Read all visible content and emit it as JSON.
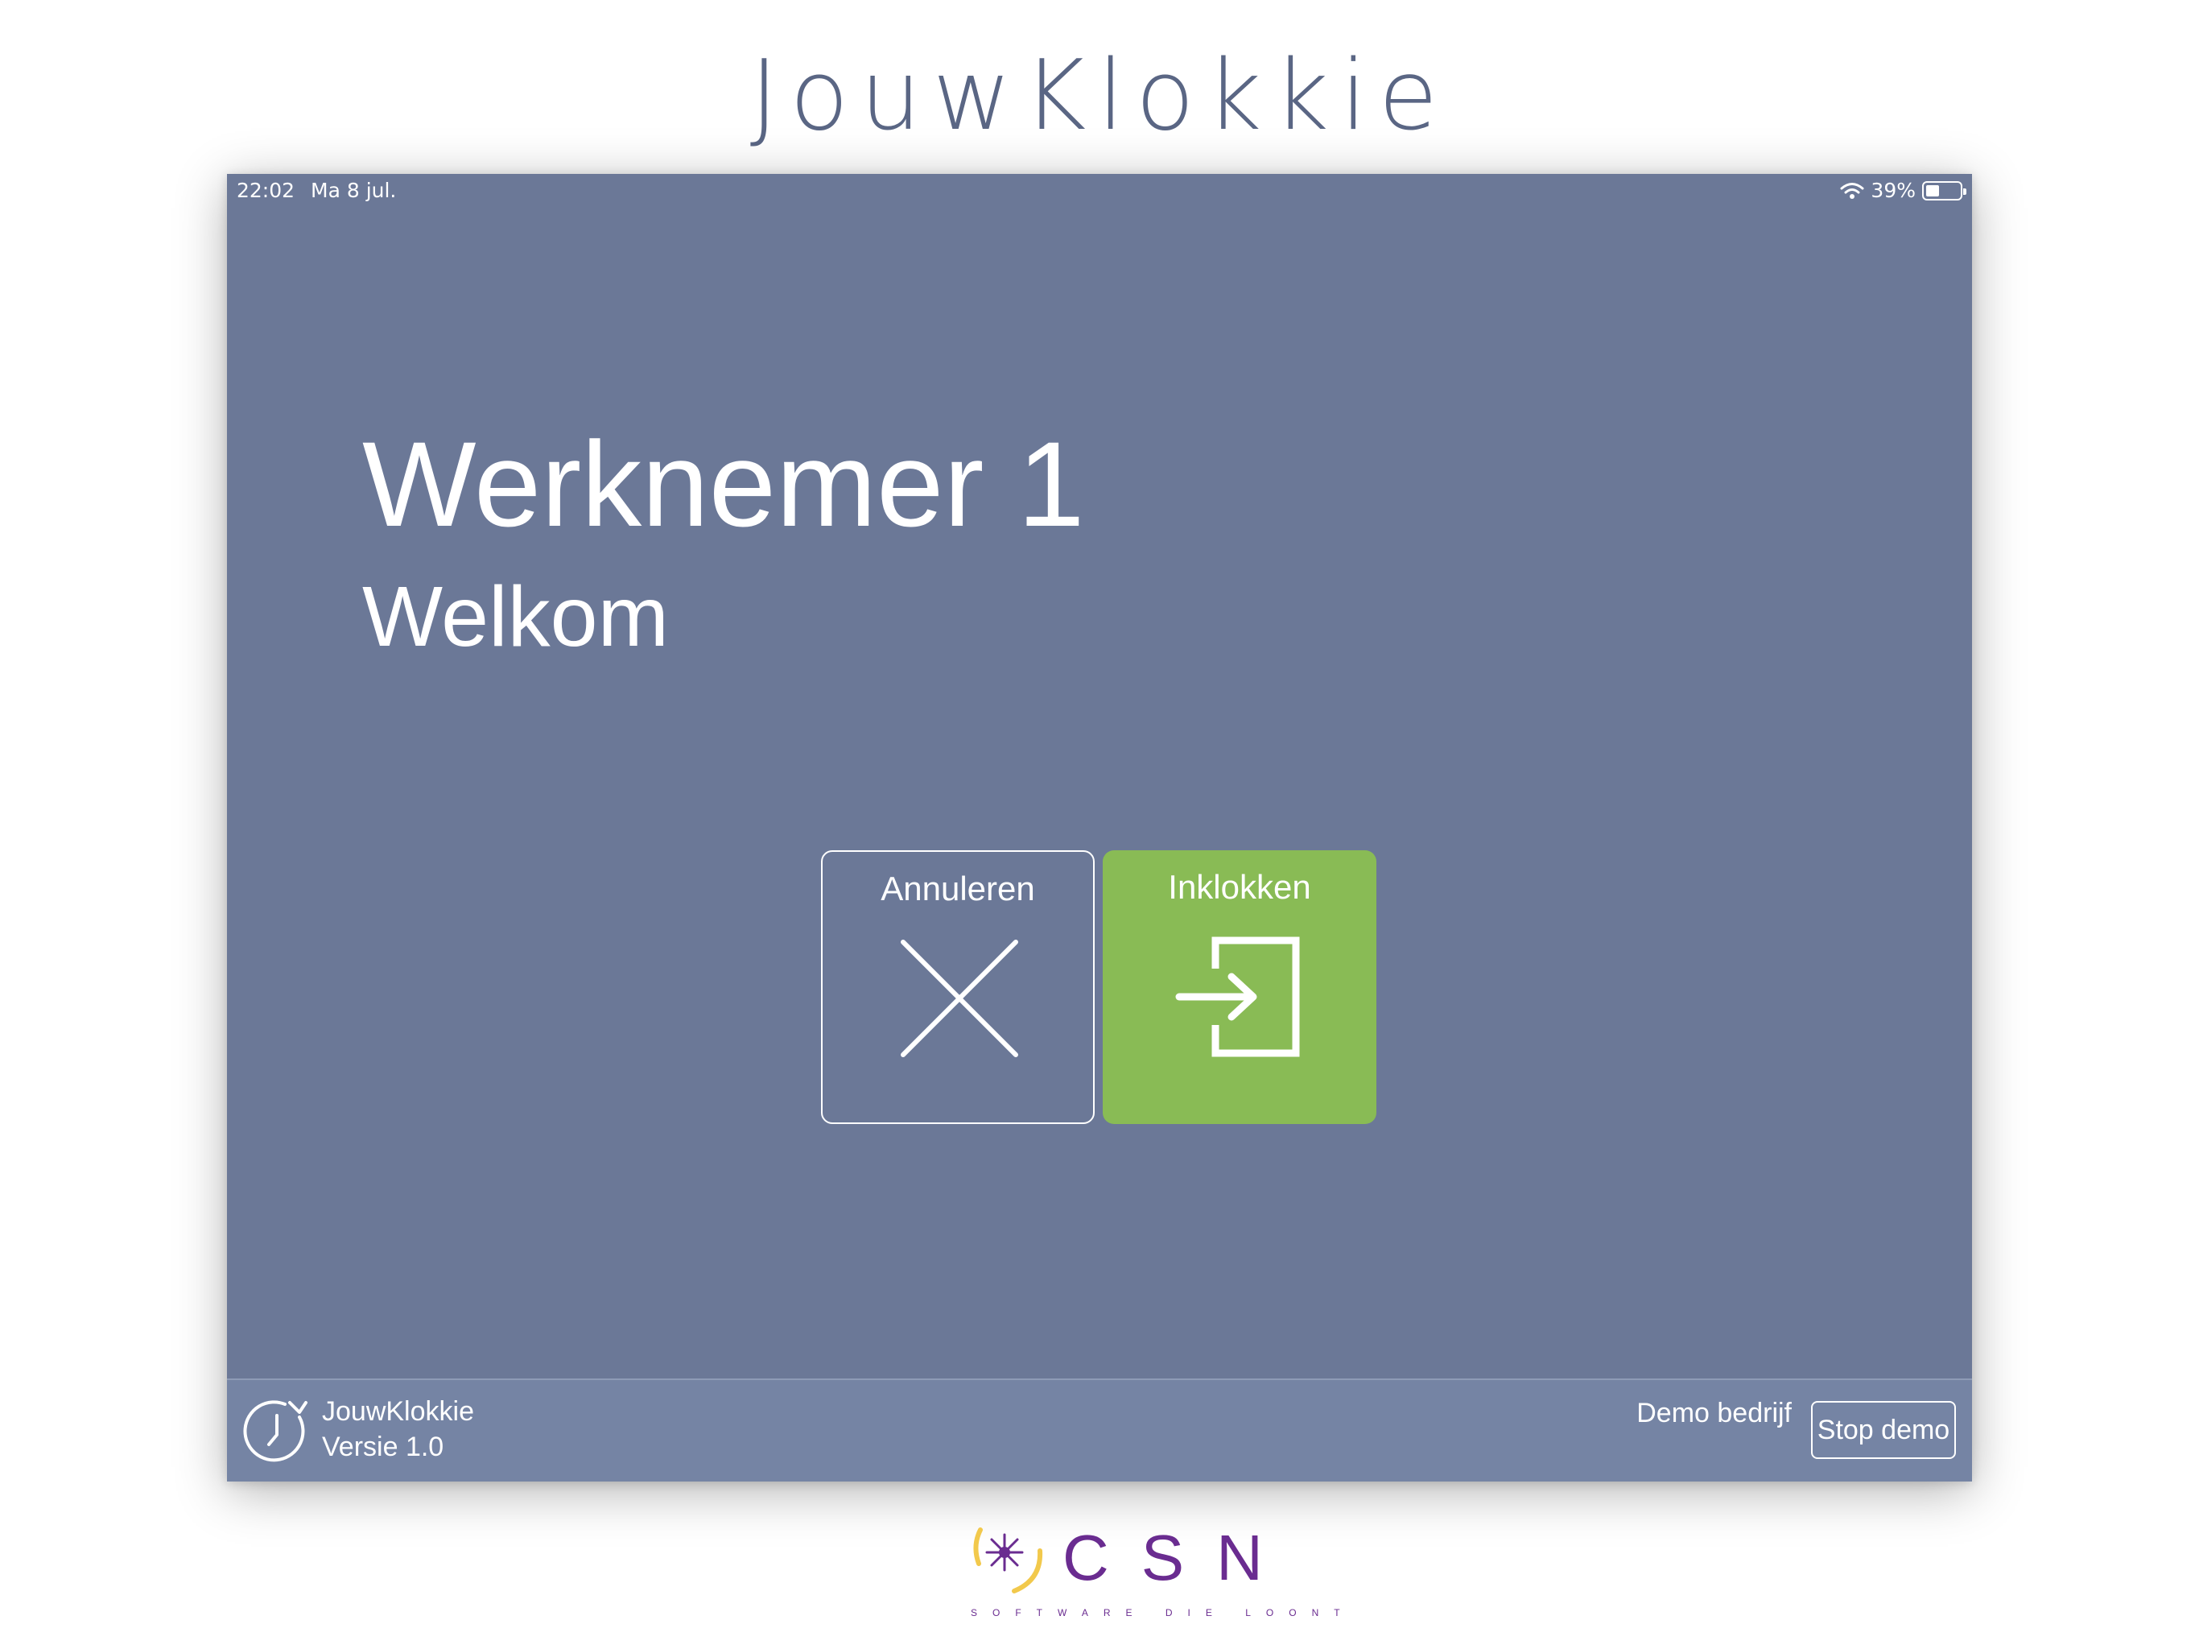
{
  "page_title": "JouwKlokkie",
  "status_bar": {
    "time": "22:02",
    "date": "Ma 8 jul.",
    "battery_percent": "39%",
    "battery_level": 0.39
  },
  "employee": {
    "name": "Werknemer 1",
    "greeting": "Welkom"
  },
  "actions": {
    "cancel_label": "Annuleren",
    "clockin_label": "Inklokken"
  },
  "footer": {
    "app_name": "JouwKlokkie",
    "app_version": "Versie 1.0",
    "company": "Demo bedrijf",
    "stop_demo_label": "Stop demo"
  },
  "brand": {
    "letters": "CSN",
    "tagline": "SOFTWARE DIE LOONT"
  },
  "colors": {
    "background_panel": "#6b7897",
    "footer_bar": "#7584a4",
    "clockin_green": "#89bb55",
    "title_text": "#5a6684",
    "brand_purple": "#6a2c90",
    "brand_yellow": "#f2c94c"
  },
  "icons": {
    "cancel": "close-x-icon",
    "clockin": "login-arrow-icon",
    "footer_logo": "clock-refresh-icon",
    "wifi": "wifi-icon",
    "battery": "battery-icon"
  }
}
